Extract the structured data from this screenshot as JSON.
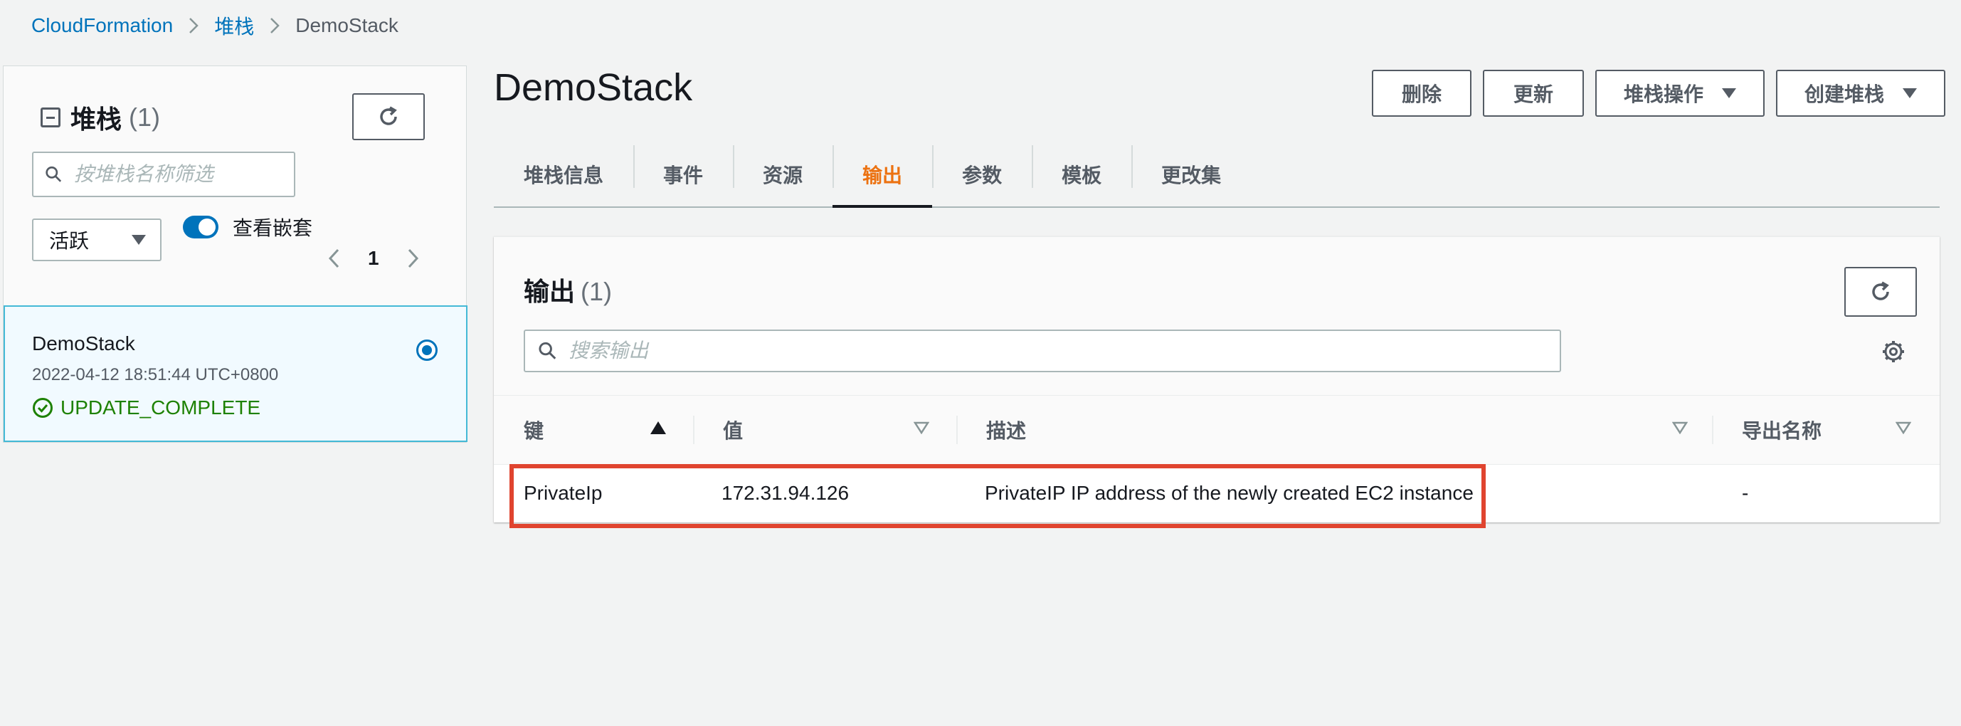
{
  "breadcrumb": {
    "root": "CloudFormation",
    "stacks": "堆栈",
    "current": "DemoStack"
  },
  "left_panel": {
    "title": "堆栈",
    "count": "(1)",
    "search_placeholder": "按堆栈名称筛选",
    "filter_value": "活跃",
    "toggle_label": "查看嵌套",
    "page": "1",
    "stack": {
      "name": "DemoStack",
      "date": "2022-04-12 18:51:44 UTC+0800",
      "status": "UPDATE_COMPLETE"
    }
  },
  "main": {
    "title": "DemoStack",
    "buttons": {
      "delete": "删除",
      "update": "更新",
      "stack_actions": "堆栈操作",
      "create_stack": "创建堆栈"
    },
    "tabs": [
      "堆栈信息",
      "事件",
      "资源",
      "输出",
      "参数",
      "模板",
      "更改集"
    ],
    "active_tab": "输出"
  },
  "outputs": {
    "title": "输出",
    "count": "(1)",
    "search_placeholder": "搜索输出",
    "columns": {
      "key": "键",
      "value": "值",
      "description": "描述",
      "export_name": "导出名称"
    },
    "rows": [
      {
        "key": "PrivateIp",
        "value": "172.31.94.126",
        "description": "PrivateIP IP address of the newly created EC2 instance",
        "export_name": "-"
      }
    ]
  },
  "colors": {
    "link": "#0073bb",
    "active_tab": "#ec7211",
    "success": "#1d8102",
    "highlight": "#e0442f"
  }
}
